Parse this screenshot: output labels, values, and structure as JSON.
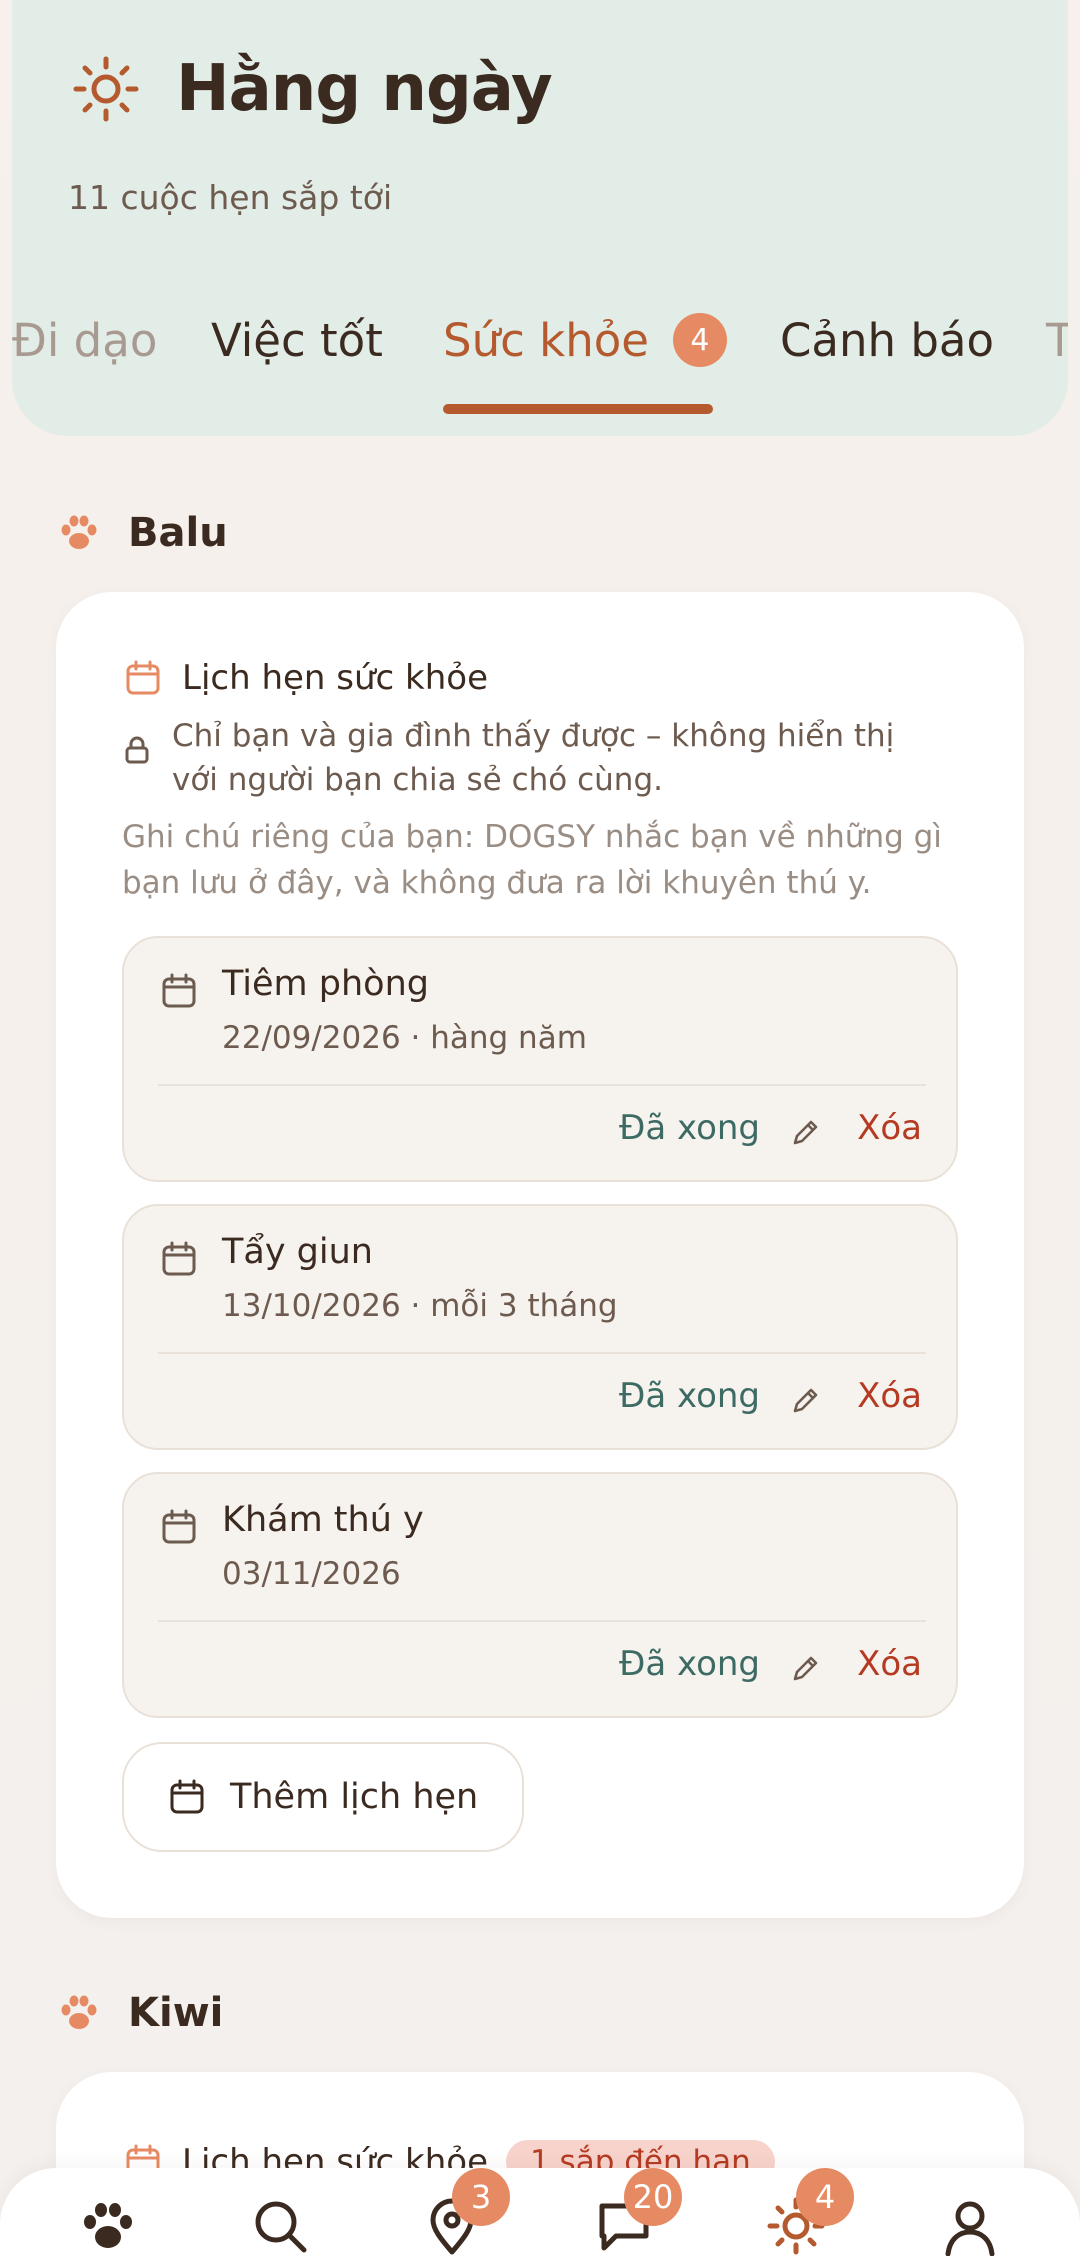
{
  "colors": {
    "header_bg": "#e2ede8",
    "accent": "#b55a2e",
    "badge": "#e68a63",
    "done": "#3d6b64",
    "delete": "#b53a22"
  },
  "header": {
    "title": "Hằng ngày",
    "title_icon": "sun-icon",
    "subtitle": "11 cuộc hẹn sắp tới",
    "tabs": [
      {
        "label": "Đi dạo"
      },
      {
        "label": "Việc tốt"
      },
      {
        "label": "Sức khỏe",
        "badge": "4",
        "active": true
      },
      {
        "label": "Cảnh báo"
      },
      {
        "label": "T"
      }
    ]
  },
  "pets": [
    {
      "name": "Balu",
      "card": {
        "title": "Lịch hẹn sức khỏe",
        "privacy": "Chỉ bạn và gia đình thấy được – không hiển thị với người bạn chia sẻ chó cùng.",
        "note": "Ghi chú riêng của bạn: DOGSY nhắc bạn về những gì bạn lưu ở đây, và không đưa ra lời khuyên thú y.",
        "appointments": [
          {
            "title": "Tiêm phòng",
            "date": "22/09/2026 · hàng năm"
          },
          {
            "title": "Tẩy giun",
            "date": "13/10/2026 · mỗi 3 tháng"
          },
          {
            "title": "Khám thú y",
            "date": "03/11/2026"
          }
        ],
        "done_label": "Đã xong",
        "delete_label": "Xóa",
        "add_label": "Thêm lịch hẹn"
      }
    },
    {
      "name": "Kiwi",
      "card": {
        "title": "Lịch hẹn sức khỏe",
        "due_pill": "1 sắp đến hạn"
      }
    }
  ],
  "bottom_nav": [
    {
      "icon": "paw-icon"
    },
    {
      "icon": "search-icon"
    },
    {
      "icon": "map-pin-icon",
      "badge": "3"
    },
    {
      "icon": "chat-icon",
      "badge": "20"
    },
    {
      "icon": "sun-icon",
      "badge": "4"
    },
    {
      "icon": "profile-icon"
    }
  ]
}
